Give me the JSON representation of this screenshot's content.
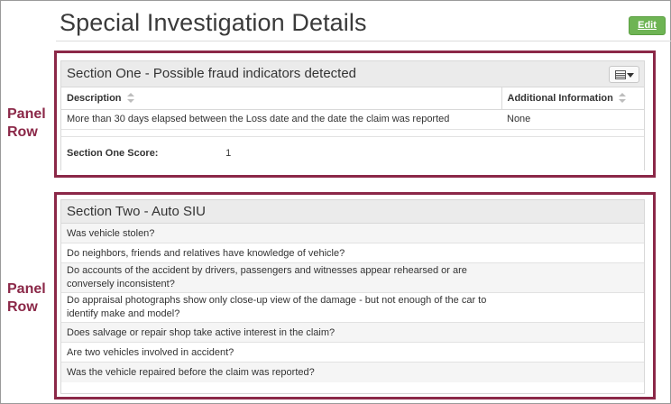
{
  "page": {
    "title": "Special Investigation Details",
    "edit_label": "Edit"
  },
  "annotations": {
    "panel_row_1": [
      "Panel",
      "Row"
    ],
    "panel_row_2": [
      "Panel",
      "Row"
    ]
  },
  "section_one": {
    "title": "Section One - Possible fraud indicators detected",
    "view_toggle_icon": "table-icon",
    "columns": [
      "Description",
      "Additional Information"
    ],
    "rows": [
      [
        "More than 30 days elapsed between the Loss date and the date the claim was reported",
        "None"
      ]
    ],
    "score_label": "Section One Score:",
    "score_value": "1"
  },
  "section_two": {
    "title": "Section Two - Auto SIU",
    "questions": [
      "Was vehicle stolen?",
      "Do neighbors, friends and relatives have knowledge of vehicle?",
      "Do accounts of the accident by drivers, passengers and witnesses appear rehearsed or are conversely inconsistent?",
      "Do appraisal photographs show only close-up view of the damage - but not enough of the car to identify make and model?",
      "Does salvage or repair shop take active interest in the claim?",
      "Are two vehicles involved in accident?",
      "Was the vehicle repaired before the claim was reported?"
    ]
  },
  "colors": {
    "accent": "#8b2848",
    "edit_button": "#6eb454",
    "header_bg": "#ebebeb"
  }
}
